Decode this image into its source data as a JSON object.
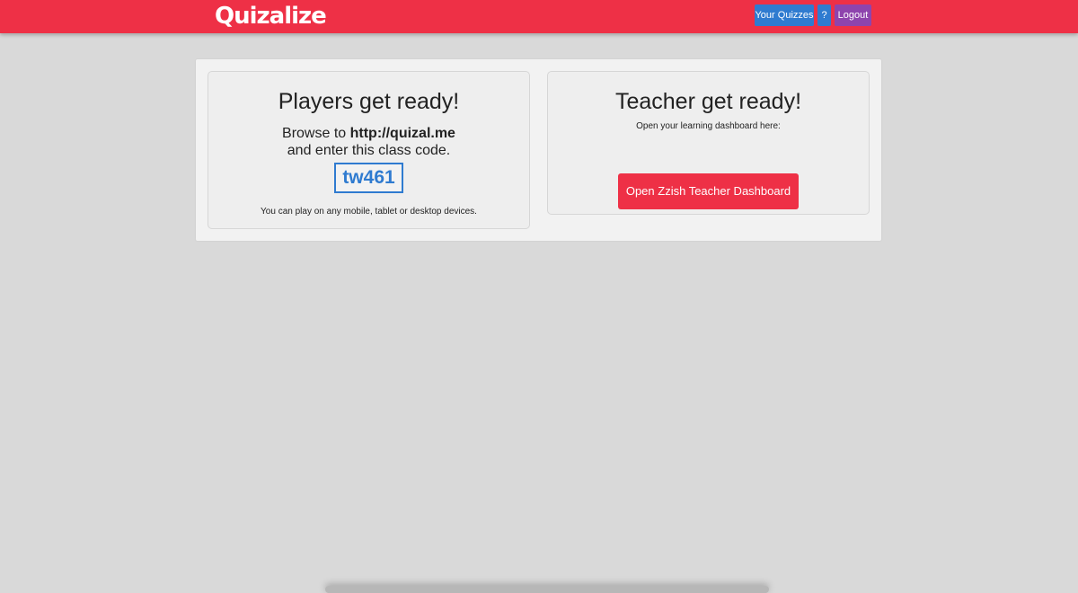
{
  "header": {
    "logo_text": "Quizalize",
    "nav": {
      "your_quizzes_label": "Your Quizzes",
      "help_label": "?",
      "logout_label": "Logout"
    }
  },
  "players_panel": {
    "title": "Players get ready!",
    "browse_prefix": "Browse to ",
    "browse_url": "http://quizal.me",
    "browse_suffix": "and enter this class code.",
    "class_code": "tw461",
    "devices_note": "You can play on any mobile, tablet or desktop devices."
  },
  "teacher_panel": {
    "title": "Teacher get ready!",
    "dashboard_label": "Open your learning dashboard here:",
    "dashboard_button_label": "Open Zzish Teacher Dashboard"
  },
  "colors": {
    "brand_red": "#ee3046",
    "accent_blue": "#2f7bd0",
    "logout_purple": "#8e44ad",
    "page_background": "#d9d9d9"
  }
}
